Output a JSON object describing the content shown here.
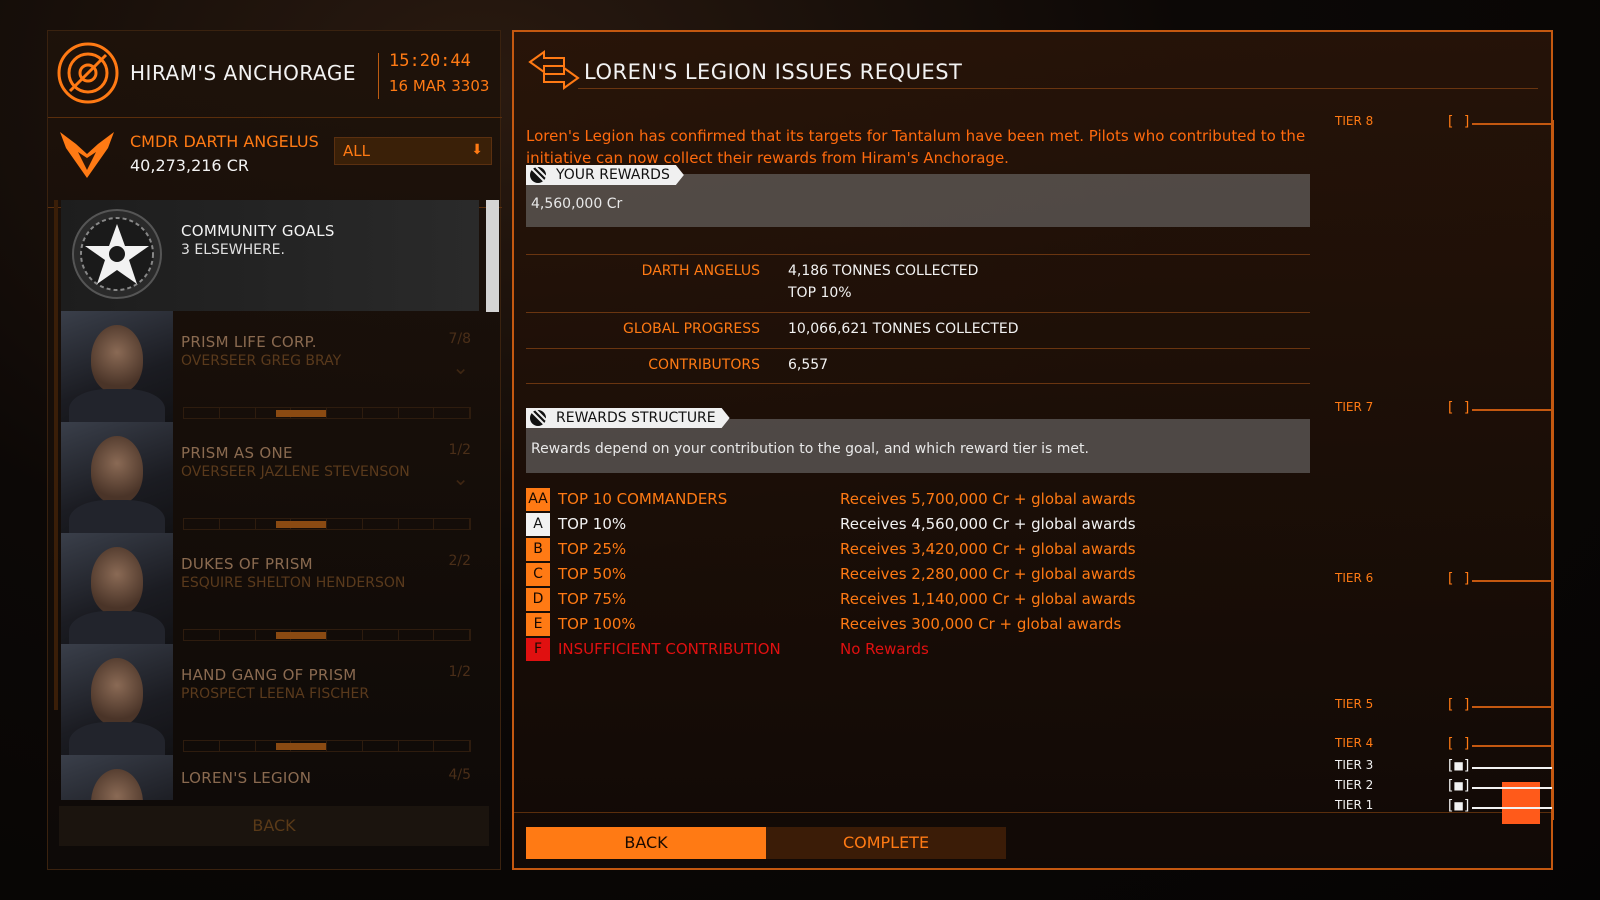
{
  "station": {
    "name": "HIRAM'S ANCHORAGE",
    "time": "15:20:44",
    "date": "16 MAR 3303"
  },
  "commander": {
    "name": "CMDR DARTH ANGELUS",
    "credits": "40,273,216 CR",
    "filter": "ALL"
  },
  "goal_list": {
    "selected": {
      "title": "COMMUNITY GOALS",
      "subtitle": "3 ELSEWHERE."
    },
    "items": [
      {
        "title": "PRISM LIFE CORP.",
        "subtitle": "OVERSEER GREG BRAY",
        "count": "7/8"
      },
      {
        "title": "PRISM AS ONE",
        "subtitle": "OVERSEER JAZLENE STEVENSON",
        "count": "1/2"
      },
      {
        "title": "DUKES OF PRISM",
        "subtitle": "ESQUIRE SHELTON HENDERSON",
        "count": "2/2"
      },
      {
        "title": "HAND GANG OF PRISM",
        "subtitle": "PROSPECT LEENA FISCHER",
        "count": "1/2"
      },
      {
        "title": "LOREN'S LEGION",
        "subtitle": "",
        "count": "4/5"
      }
    ],
    "back_label": "BACK"
  },
  "main": {
    "title": "LOREN'S LEGION ISSUES REQUEST",
    "description": "Loren's Legion has confirmed that its targets for Tantalum have been met. Pilots who contributed to the initiative can now collect their rewards from Hiram's Anchorage.",
    "your_rewards": {
      "tag": "YOUR REWARDS",
      "value": "4,560,000 Cr"
    },
    "stats": [
      {
        "label": "DARTH ANGELUS",
        "value": "4,186 TONNES COLLECTED",
        "value2": "TOP 10%"
      },
      {
        "label": "GLOBAL PROGRESS",
        "value": "10,066,621 TONNES COLLECTED"
      },
      {
        "label": "CONTRIBUTORS",
        "value": "6,557"
      }
    ],
    "rewards_structure": {
      "tag": "REWARDS STRUCTURE",
      "text": "Rewards depend on your contribution to the goal, and which reward tier is met."
    },
    "tiers": [
      {
        "badge": "AA",
        "name": "TOP 10 COMMANDERS",
        "reward": "Receives 5,700,000 Cr + global awards"
      },
      {
        "badge": "A",
        "name": "TOP 10%",
        "reward": "Receives 4,560,000 Cr + global awards"
      },
      {
        "badge": "B",
        "name": "TOP 25%",
        "reward": "Receives 3,420,000 Cr + global awards"
      },
      {
        "badge": "C",
        "name": "TOP 50%",
        "reward": "Receives 2,280,000 Cr + global awards"
      },
      {
        "badge": "D",
        "name": "TOP 75%",
        "reward": "Receives 1,140,000 Cr + global awards"
      },
      {
        "badge": "E",
        "name": "TOP 100%",
        "reward": "Receives 300,000 Cr + global awards"
      },
      {
        "badge": "F",
        "name": "INSUFFICIENT CONTRIBUTION",
        "reward": "No Rewards"
      }
    ],
    "back_label": "BACK",
    "complete_label": "COMPLETE"
  },
  "tier_track": [
    {
      "label": "TIER 8",
      "box": "[ ]"
    },
    {
      "label": "TIER 7",
      "box": "[ ]"
    },
    {
      "label": "TIER 6",
      "box": "[ ]"
    },
    {
      "label": "TIER 5",
      "box": "[ ]"
    },
    {
      "label": "TIER 4",
      "box": "[ ]"
    },
    {
      "label": "TIER 3",
      "box": "[■]"
    },
    {
      "label": "TIER 2",
      "box": "[■]"
    },
    {
      "label": "TIER 1",
      "box": "[■]"
    }
  ],
  "colors": {
    "accent": "#ff7a14",
    "highlight_white": "#f2f2f2",
    "insufficient_red": "#e01010",
    "tier_fill": "#ff5a1a"
  }
}
